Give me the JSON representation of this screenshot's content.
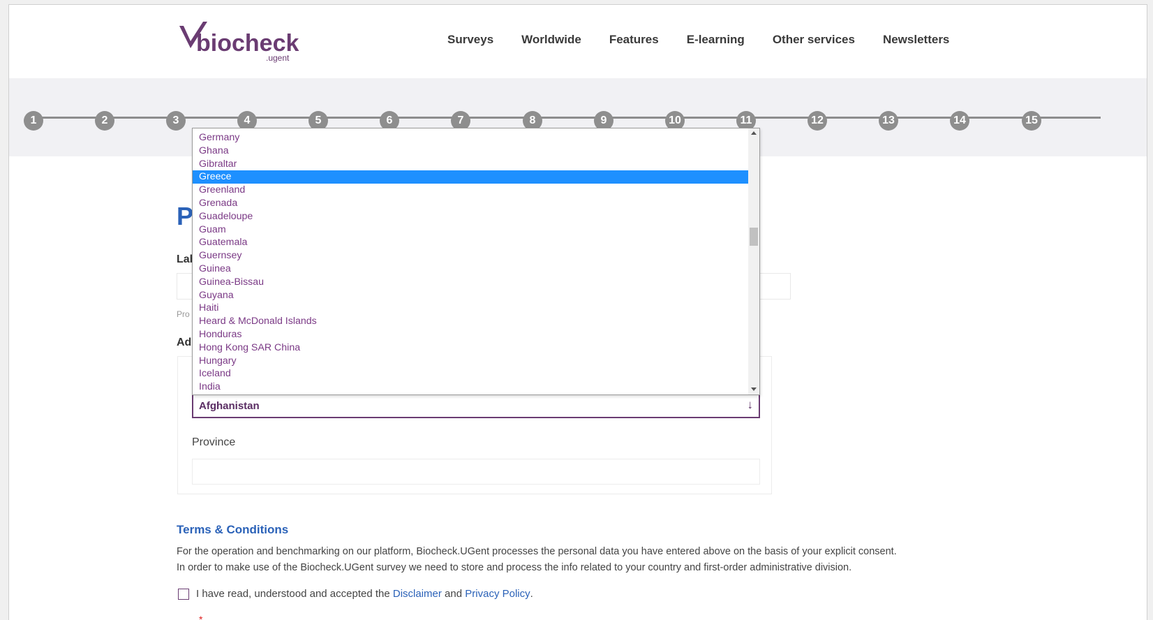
{
  "header": {
    "logo_text": "biocheck",
    "logo_sub": ".ugent",
    "nav": [
      "Surveys",
      "Worldwide",
      "Features",
      "E-learning",
      "Other services",
      "Newsletters"
    ]
  },
  "steps": [
    "1",
    "2",
    "3",
    "4",
    "5",
    "6",
    "7",
    "8",
    "9",
    "10",
    "11",
    "12",
    "13",
    "14",
    "15"
  ],
  "form": {
    "title_partial": "P",
    "label_1_partial": "Lab",
    "hint_1_partial": "Pro",
    "label_2_partial": "Add",
    "country_value": "Afghanistan",
    "country_arrow": "↓",
    "province_label": "Province"
  },
  "dropdown": {
    "options": [
      "Germany",
      "Ghana",
      "Gibraltar",
      "Greece",
      "Greenland",
      "Grenada",
      "Guadeloupe",
      "Guam",
      "Guatemala",
      "Guernsey",
      "Guinea",
      "Guinea-Bissau",
      "Guyana",
      "Haiti",
      "Heard & McDonald Islands",
      "Honduras",
      "Hong Kong SAR China",
      "Hungary",
      "Iceland",
      "India"
    ],
    "highlighted": "Greece"
  },
  "terms": {
    "title": "Terms & Conditions",
    "line_1": "For the operation and benchmarking on our platform, Biocheck.UGent processes the personal data you have entered above on the basis of your explicit consent.",
    "line_2": "In order to make use of the Biocheck.UGent survey we need to store and process the info related to your country and first-order administrative division.",
    "consent_prefix": "I have read, understood and accepted the ",
    "disclaimer_link": "Disclaimer",
    "consent_and": " and ",
    "privacy_link": "Privacy Policy",
    "consent_suffix": ".",
    "required_mark": "*"
  },
  "colors": {
    "brand_purple": "#6a3c72",
    "link_blue": "#2b62b8",
    "highlight": "#1e90ff",
    "step_gray": "#8e8e8e"
  }
}
